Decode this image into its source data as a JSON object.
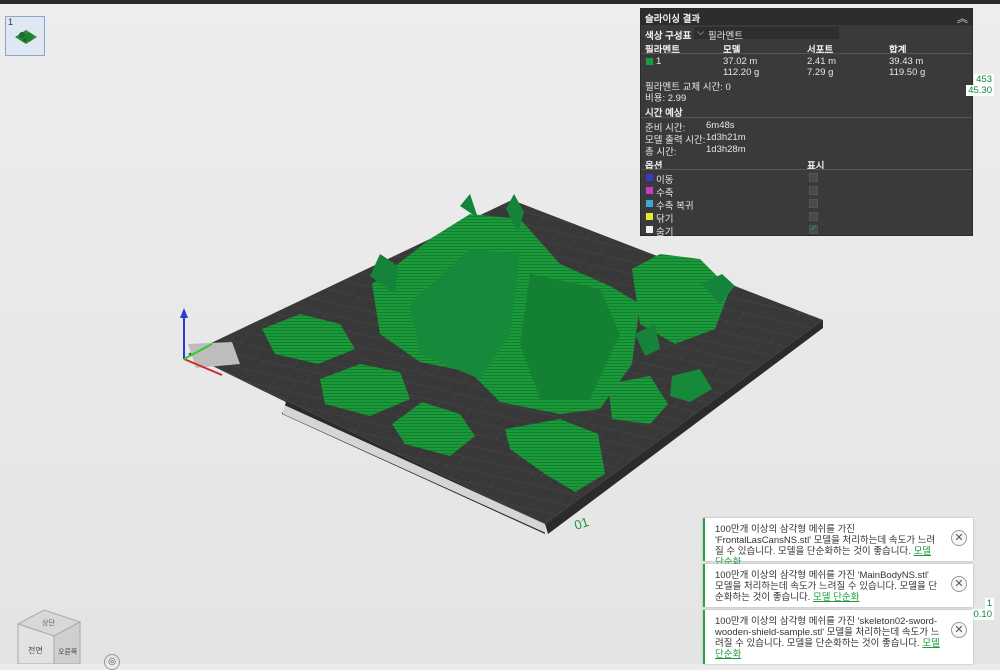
{
  "plate": {
    "thumb_index": "1",
    "bed_number": "01"
  },
  "slicing": {
    "title": "슬라이싱 결과",
    "color_scheme_label": "색상 구성표",
    "color_scheme_value": "필라멘트",
    "columns": [
      "필라멘트",
      "모델",
      "서포트",
      "합계"
    ],
    "filament": {
      "id": "1",
      "color": "#1a9e3a",
      "model_length": "37.02 m",
      "model_weight": "112.20 g",
      "support_length": "2.41 m",
      "support_weight": "7.29 g",
      "total_length": "39.43 m",
      "total_weight": "119.50 g"
    },
    "change_time": "필라멘트 교체 시간: 0",
    "cost": "비용: 2.99",
    "time_section": "시간 예상",
    "prep_label": "준비 시간:",
    "prep_value": "6m48s",
    "model_print_label": "모델 출력 시간:",
    "model_print_value": "1d3h21m",
    "total_label": "총 시간:",
    "total_value": "1d3h28m",
    "options_label": "옵션",
    "display_label": "표시",
    "options": [
      {
        "label": "이동",
        "color": "#3a3ac8",
        "checked": false
      },
      {
        "label": "수축",
        "color": "#c83ac8",
        "checked": false
      },
      {
        "label": "수축 복귀",
        "color": "#3aa8d8",
        "checked": false
      },
      {
        "label": "닦기",
        "color": "#e8e830",
        "checked": false
      },
      {
        "label": "숨기",
        "color": "#f0f0f0",
        "checked": true
      }
    ]
  },
  "layer_slider": {
    "top_value": "453",
    "top_height": "45.30",
    "bottom_value": "1",
    "bottom_height": "0.10"
  },
  "notifications": [
    {
      "text": "100만개 이상의 삼각형 메쉬를 가진 'FrontalLasCansNS.stl' 모델을 처리하는데 속도가 느려질 수 있습니다. 모델을 단순화하는 것이 좋습니다.",
      "link": "모델 단순화"
    },
    {
      "text": "100만개 이상의 삼각형 메쉬를 가진 'MainBodyNS.stl' 모델을 처리하는데 속도가 느려질 수 있습니다. 모델을 단순화하는 것이 좋습니다.",
      "link": "모델 단순화"
    },
    {
      "text": "100만개 이상의 삼각형 메쉬를 가진 'skeleton02-sword-wooden-shield-sample.stl' 모델을 처리하는데 속도가 느려질 수 있습니다. 모델을 단순화하는 것이 좋습니다.",
      "link": "모델 단순화"
    }
  ],
  "view_cube": {
    "front": "전면",
    "right": "오른쪽",
    "top": "상단"
  }
}
